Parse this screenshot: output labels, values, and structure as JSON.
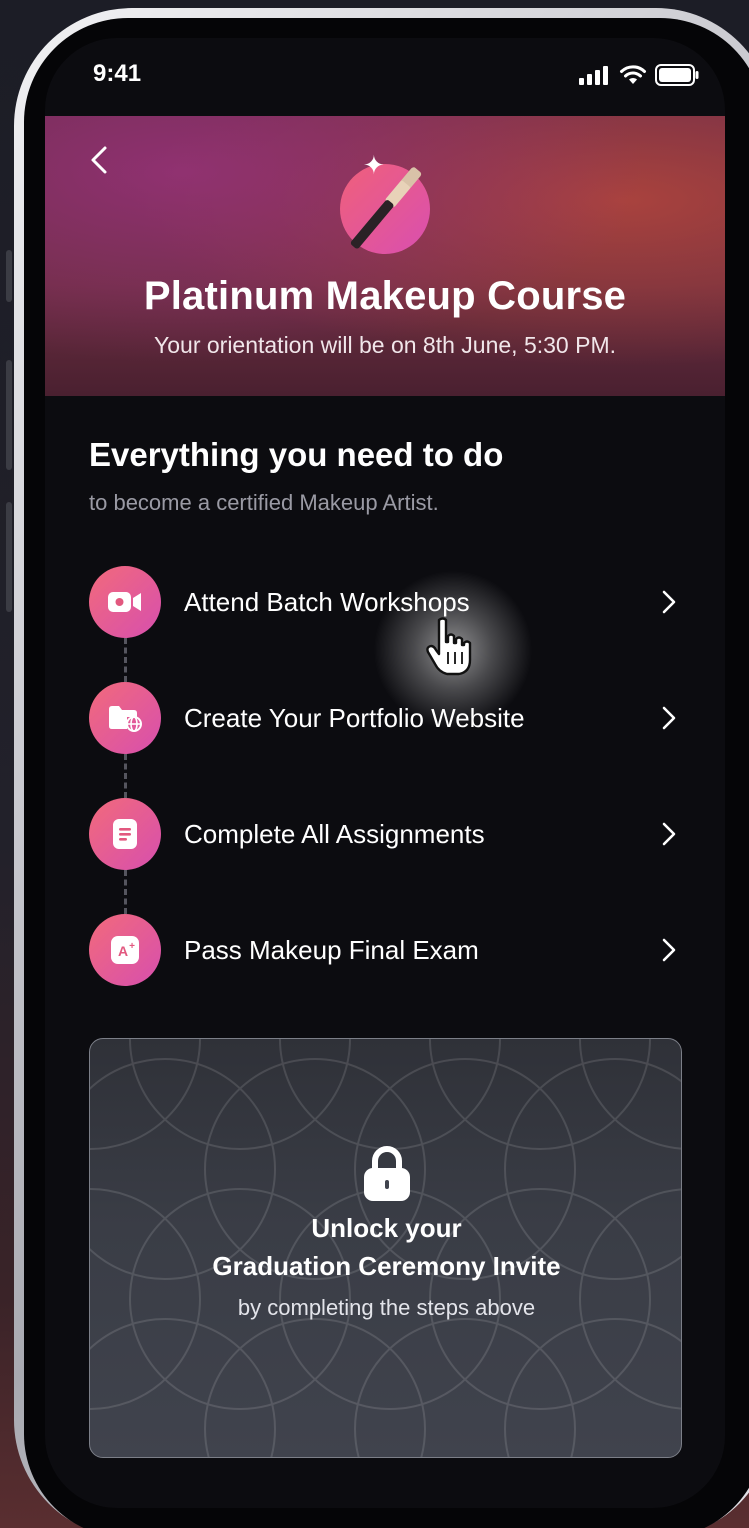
{
  "status_bar": {
    "time": "9:41",
    "icons": [
      "signal-icon",
      "wifi-icon",
      "battery-icon"
    ]
  },
  "header": {
    "back_icon": "chevron-left-icon",
    "course_icon": "makeup-brush-icon",
    "title": "Platinum Makeup Course",
    "subtitle": "Your orientation will be on 8th June, 5:30 PM."
  },
  "todo": {
    "title": "Everything you need to do",
    "subtitle": "to become a certified Makeup Artist.",
    "steps": [
      {
        "label": "Attend Batch Workshops",
        "icon": "video-camera-icon"
      },
      {
        "label": "Create Your Portfolio Website",
        "icon": "folder-globe-icon"
      },
      {
        "label": "Complete All Assignments",
        "icon": "document-icon"
      },
      {
        "label": "Pass Makeup Final Exam",
        "icon": "grade-a-plus-icon"
      }
    ]
  },
  "locked_card": {
    "icon": "lock-icon",
    "line1": "Unlock your",
    "line2": "Graduation Ceremony Invite",
    "line3": "by completing the steps above"
  },
  "colors": {
    "accent_start": "#f26a7b",
    "accent_end": "#d74fae",
    "background": "#0c0c10"
  }
}
